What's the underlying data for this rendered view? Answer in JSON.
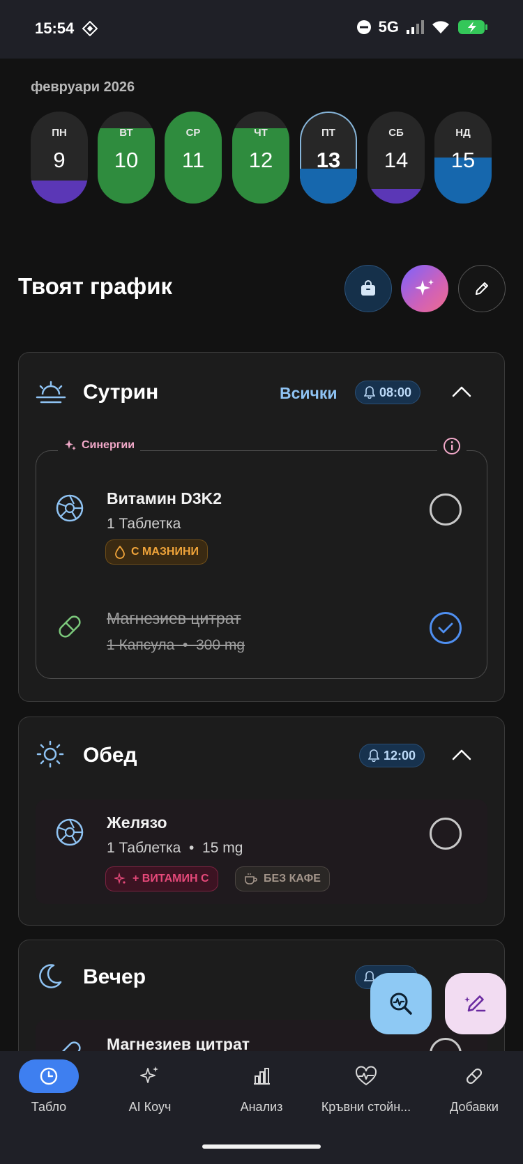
{
  "status_bar": {
    "time": "15:54",
    "network": "5G"
  },
  "calendar": {
    "month_label": "февруари 2026",
    "days": [
      {
        "name": "ПН",
        "num": "9",
        "fill_level": 0.25,
        "fill_color": "#5b37b6",
        "selected": false
      },
      {
        "name": "ВТ",
        "num": "10",
        "fill_level": 0.82,
        "fill_color": "#2f8c3e",
        "selected": false
      },
      {
        "name": "СР",
        "num": "11",
        "fill_level": 1.0,
        "fill_color": "#2f8c3e",
        "selected": false
      },
      {
        "name": "ЧТ",
        "num": "12",
        "fill_level": 0.82,
        "fill_color": "#2f8c3e",
        "selected": false
      },
      {
        "name": "ПТ",
        "num": "13",
        "fill_level": 0.38,
        "fill_color": "#1667ad",
        "selected": true
      },
      {
        "name": "СБ",
        "num": "14",
        "fill_level": 0.16,
        "fill_color": "#5b37b6",
        "selected": false
      },
      {
        "name": "НД",
        "num": "15",
        "fill_level": 0.5,
        "fill_color": "#1667ad",
        "selected": false
      }
    ]
  },
  "schedule": {
    "title": "Твоят график"
  },
  "morning": {
    "name": "Сутрин",
    "all_link": "Всички",
    "time": "08:00",
    "synergy_label": "Синергии",
    "items": [
      {
        "name": "Витамин D3K2",
        "sub": "1 Таблетка",
        "tag": "С МАЗНИНИ",
        "done": false
      },
      {
        "name": "Магнезиев цитрат",
        "sub": "1 Капсула  •  300 mg",
        "done": true
      }
    ]
  },
  "noon": {
    "name": "Обед",
    "time": "12:00",
    "items": [
      {
        "name": "Желязо",
        "sub": "1 Таблетка  •  15 mg",
        "tags": [
          "+ ВИТАМИН С",
          "БЕЗ КАФЕ"
        ],
        "done": false
      }
    ]
  },
  "evening": {
    "name": "Вечер",
    "items": [
      {
        "name": "Магнезиев цитрат"
      }
    ]
  },
  "nav": [
    {
      "label": "Табло",
      "icon": "clock-icon",
      "active": true
    },
    {
      "label": "AI Коуч",
      "icon": "sparkles-icon",
      "active": false
    },
    {
      "label": "Анализ",
      "icon": "bar-chart-icon",
      "active": false
    },
    {
      "label": "Кръвни стойн...",
      "icon": "heart-pulse-icon",
      "active": false
    },
    {
      "label": "Добавки",
      "icon": "pill-icon",
      "active": false
    }
  ],
  "colors": {
    "accent": "#3e7ff0",
    "link": "#8fc3f3",
    "fat_tag": "#f0a43a",
    "vitamin_tag": "#e6497a",
    "coffee_tag": "#a3958a"
  }
}
